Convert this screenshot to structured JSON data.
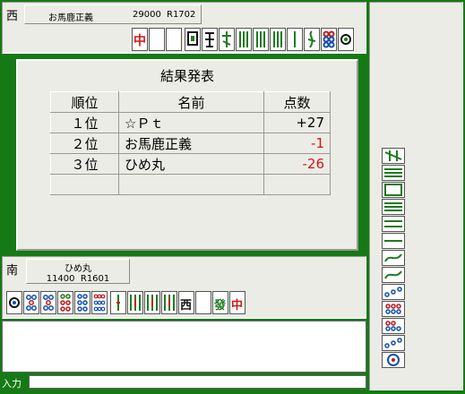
{
  "players": {
    "west": {
      "wind": "西",
      "name": "お馬鹿正義",
      "score": "29000",
      "rating": "R1702"
    },
    "south": {
      "wind": "南",
      "name": "ひめ丸",
      "score": "11400",
      "rating": "R1601"
    }
  },
  "result": {
    "title": "結果発表",
    "headers": [
      "順位",
      "名前",
      "点数"
    ],
    "rows": [
      {
        "rank": "１位",
        "name": "☆Ｐｔ",
        "score": "+27"
      },
      {
        "rank": "２位",
        "name": "お馬鹿正義",
        "score": "-1"
      },
      {
        "rank": "３位",
        "name": "ひめ丸",
        "score": "-26"
      }
    ]
  },
  "tiles": {
    "west_hand": [
      "中",
      "",
      "",
      "索",
      "索",
      "索",
      "索",
      "索",
      "索",
      "索",
      "索",
      "筒",
      "筒"
    ],
    "south_hand": [
      "筒",
      "筒",
      "筒",
      "筒",
      "筒",
      "筒",
      "索",
      "索",
      "索",
      "索",
      "西",
      "",
      "發",
      "中"
    ],
    "south_chars": {
      "west": "西",
      "hatsu": "發",
      "chun": "中"
    },
    "west_chars": {
      "chun": "中"
    }
  },
  "input": {
    "label": "入力",
    "value": ""
  },
  "colors": {
    "table_green": "#157a15",
    "panel": "#ecece6",
    "negative": "#d01818"
  }
}
